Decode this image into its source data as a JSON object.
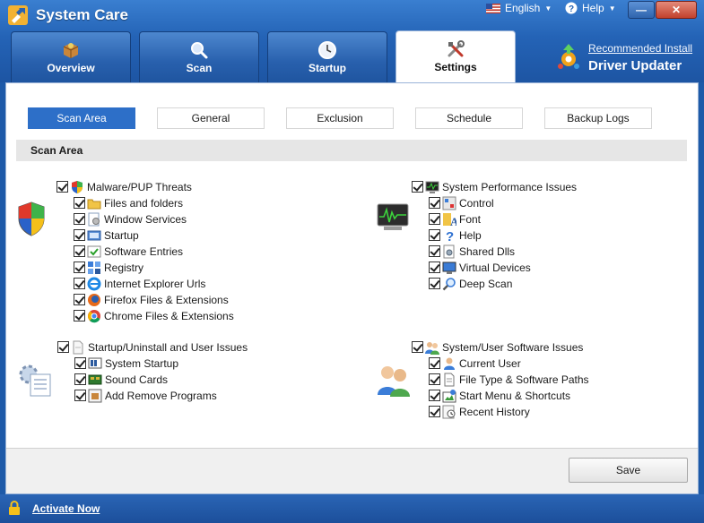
{
  "app": {
    "title": "System Care"
  },
  "top_menu": {
    "language": "English",
    "help": "Help"
  },
  "window_controls": {
    "minimize": "—",
    "close": "✕"
  },
  "main_tabs": [
    {
      "label": "Overview",
      "icon": "box-icon"
    },
    {
      "label": "Scan",
      "icon": "magnifier-icon"
    },
    {
      "label": "Startup",
      "icon": "clock-icon"
    },
    {
      "label": "Settings",
      "icon": "tools-icon",
      "active": true
    }
  ],
  "promo": {
    "link": "Recommended Install",
    "title": "Driver Updater"
  },
  "sub_tabs": [
    {
      "label": "Scan Area",
      "active": true
    },
    {
      "label": "General"
    },
    {
      "label": "Exclusion"
    },
    {
      "label": "Schedule"
    },
    {
      "label": "Backup Logs"
    }
  ],
  "section_title": "Scan Area",
  "groups": {
    "malware": {
      "title": "Malware/PUP Threats",
      "checked": true,
      "items": [
        "Files and folders",
        "Window Services",
        "Startup",
        "Software Entries",
        "Registry",
        "Internet Explorer Urls",
        "Firefox Files & Extensions",
        "Chrome Files & Extensions"
      ]
    },
    "performance": {
      "title": "System Performance Issues",
      "checked": true,
      "items": [
        "Control",
        "Font",
        "Help",
        "Shared Dlls",
        "Virtual Devices",
        "Deep Scan"
      ]
    },
    "startup": {
      "title": "Startup/Uninstall and User Issues",
      "checked": true,
      "items": [
        "System Startup",
        "Sound Cards",
        "Add Remove Programs"
      ]
    },
    "software": {
      "title": "System/User Software Issues",
      "checked": true,
      "items": [
        "Current User",
        "File Type & Software Paths",
        "Start Menu & Shortcuts",
        "Recent History"
      ]
    }
  },
  "save_label": "Save",
  "footer": {
    "activate": "Activate Now"
  },
  "colors": {
    "title_blue": "#2463b6",
    "active_subtab": "#2d6fc8",
    "section_bar": "#e6e6e6"
  }
}
